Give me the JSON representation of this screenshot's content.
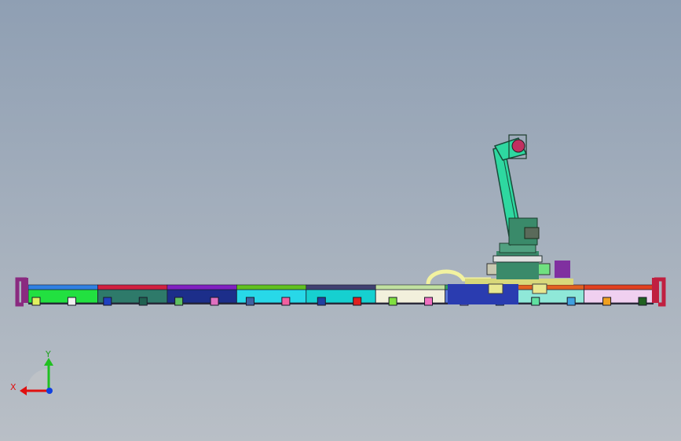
{
  "viewport": {
    "background_top": "#8f9fb3",
    "background_bottom": "#b9bfc6"
  },
  "triad": {
    "x_label": "X",
    "y_label": "Y",
    "x_color": "#e01010",
    "y_color": "#20c020",
    "z_color": "#1040e0"
  },
  "rail": {
    "segment_colors": [
      "#22e040",
      "#2e7a6a",
      "#1c2e8a",
      "#28d8e8",
      "#16d0d0",
      "#f2f0dc",
      "#5a78d8",
      "#8fe8d8",
      "#f0d0f0"
    ],
    "top_strip_colors": [
      "#3080e0",
      "#d02040",
      "#8020c0",
      "#60c020",
      "#404070",
      "#c0e0a0",
      "#30a060",
      "#e06020",
      "#e04020"
    ],
    "foot_colors": [
      "#e0f060",
      "#f0f0f0",
      "#2040c0",
      "#206050",
      "#60c060",
      "#e070c0",
      "#4060a0",
      "#f060a0",
      "#2040a0",
      "#e02020",
      "#80e040",
      "#f070c0",
      "#8080e0",
      "#3060c0",
      "#60e0a0",
      "#40a0e0",
      "#f0a020",
      "#206020"
    ],
    "end_cap_left": "#8a2a80",
    "end_cap_right": "#c02040"
  },
  "robot": {
    "arm_color": "#2ed8a0",
    "base_color": "#3a8a6a",
    "head_color": "#c03060",
    "cable_color": "#f2f2a0",
    "carriage_color": "#d8d87a",
    "motor_color": "#8030a0"
  }
}
